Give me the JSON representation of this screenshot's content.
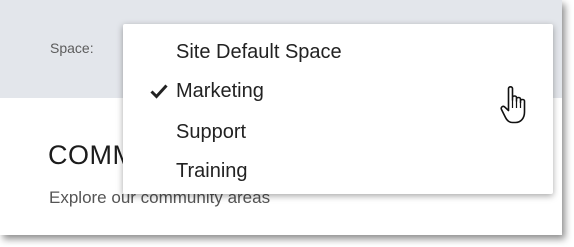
{
  "space_bar": {
    "label": "Space:",
    "dropdown": {
      "options": [
        {
          "label": "Site Default Space",
          "selected": false
        },
        {
          "label": "Marketing",
          "selected": true
        },
        {
          "label": "Support",
          "selected": false
        },
        {
          "label": "Training",
          "selected": false
        }
      ],
      "selected_icon": "checkmark-icon"
    }
  },
  "content": {
    "title": "COMMUNITY",
    "subtitle": "Explore our community areas"
  },
  "pointer": {
    "icon": "hand-pointer-icon"
  },
  "colors": {
    "space_bar_background": "#e3e6eb",
    "dropdown_background": "#ffffff",
    "text": "#222222"
  }
}
